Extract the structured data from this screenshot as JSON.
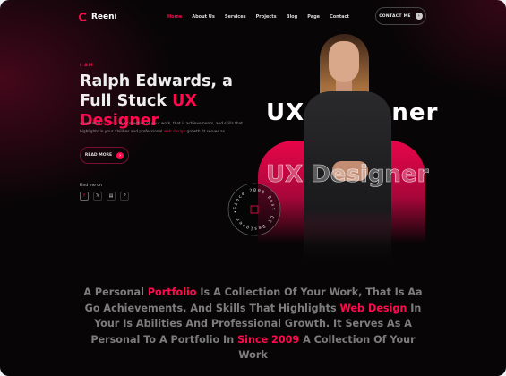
{
  "nav": {
    "brand": "Reeni",
    "items": [
      "Home",
      "About Us",
      "Services",
      "Projects",
      "Blog",
      "Page",
      "Contact"
    ],
    "active": "Home",
    "contact_label": "CONTACT ME"
  },
  "hero": {
    "eyebrow": "I AM",
    "title_1": "Ralph Edwards, a Full Stuck ",
    "title_hl": "UX Designer",
    "desc_1": "A personal ",
    "desc_hl1": "portfolio",
    "desc_2": " is a collection of your work, that is achievements, and skills that highlights in your abilities and professional ",
    "desc_hl2": "web design",
    "desc_3": " growth. It serves as",
    "read_more": "READ MORE",
    "find_me": "Find me on",
    "socials": [
      "facebook",
      "x",
      "linkedin",
      "pinterest"
    ]
  },
  "visual": {
    "ux_big": "UX Designer",
    "ux_outline": "UX Designer",
    "badge_text": "Since 2009 Best UX Designer • "
  },
  "about": {
    "p1": "A Personal ",
    "hl1": "Portfolio",
    "p2": " Is A Collection Of Your Work, That Is Aa Go Achievements, And Skills That Highlights ",
    "hl2": "Web Design",
    "p3": " In Your Is Abilities And Professional Growth. It Serves As A Personal To A Portfolio In ",
    "hl3": "Since 2009",
    "p4": " A Collection Of Your Work"
  },
  "colors": {
    "accent": "#ff0a4e",
    "background": "#070506"
  }
}
